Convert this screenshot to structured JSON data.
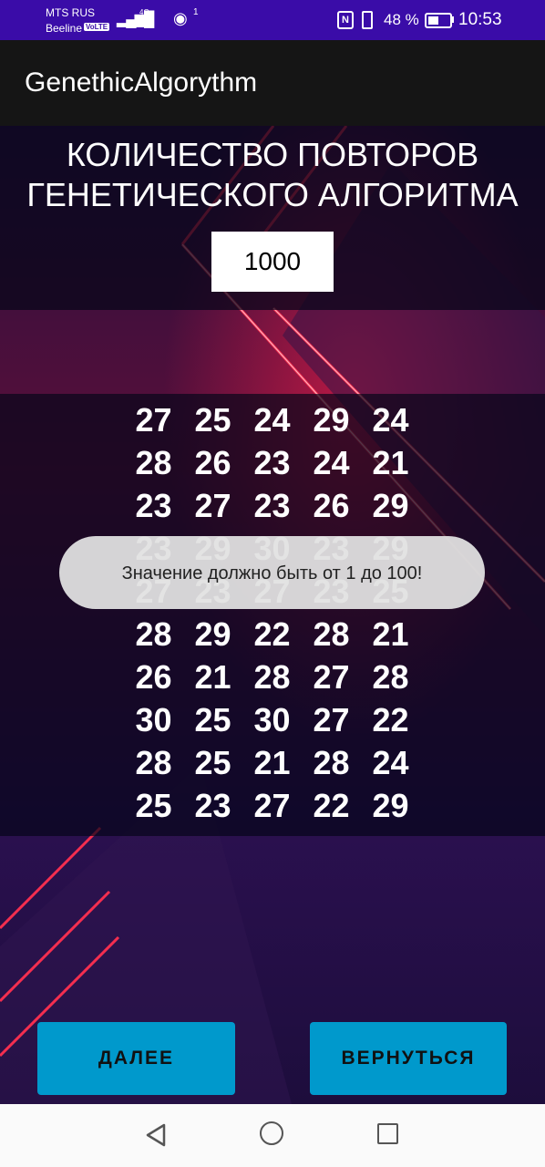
{
  "status_bar": {
    "carrier_1": "MTS RUS",
    "carrier_2": "Beeline",
    "volte": "VoLTE",
    "network": "4G",
    "hotspot_count": "1",
    "nfc": "N",
    "battery": "48 %",
    "time": "10:53"
  },
  "app_bar": {
    "title": "GenethicAlgorythm"
  },
  "heading": {
    "line1": "КОЛИЧЕСТВО ПОВТОРОВ",
    "line2": "ГЕНЕТИЧЕСКОГО АЛГОРИТМА"
  },
  "repeats_input": {
    "value": "1000"
  },
  "population_grid": [
    [
      "27",
      "25",
      "24",
      "29",
      "24"
    ],
    [
      "28",
      "26",
      "23",
      "24",
      "21"
    ],
    [
      "23",
      "27",
      "23",
      "26",
      "29"
    ],
    [
      "23",
      "29",
      "30",
      "23",
      "29"
    ],
    [
      "27",
      "23",
      "27",
      "23",
      "25"
    ],
    [
      "28",
      "29",
      "22",
      "28",
      "21"
    ],
    [
      "26",
      "21",
      "28",
      "27",
      "28"
    ],
    [
      "30",
      "25",
      "30",
      "27",
      "22"
    ],
    [
      "28",
      "25",
      "21",
      "28",
      "24"
    ],
    [
      "25",
      "23",
      "27",
      "22",
      "29"
    ]
  ],
  "toast": {
    "message": "Значение должно быть от 1 до 100!"
  },
  "buttons": {
    "next": "ДАЛЕЕ",
    "back": "ВЕРНУТЬСЯ"
  },
  "nav_bar": {
    "back": "back-icon",
    "home": "home-icon",
    "recents": "recents-icon"
  },
  "colors": {
    "status_bar": "#3a0ca8",
    "app_bar": "#151515",
    "button": "#0099cc",
    "neon": "#ff2a4a"
  }
}
